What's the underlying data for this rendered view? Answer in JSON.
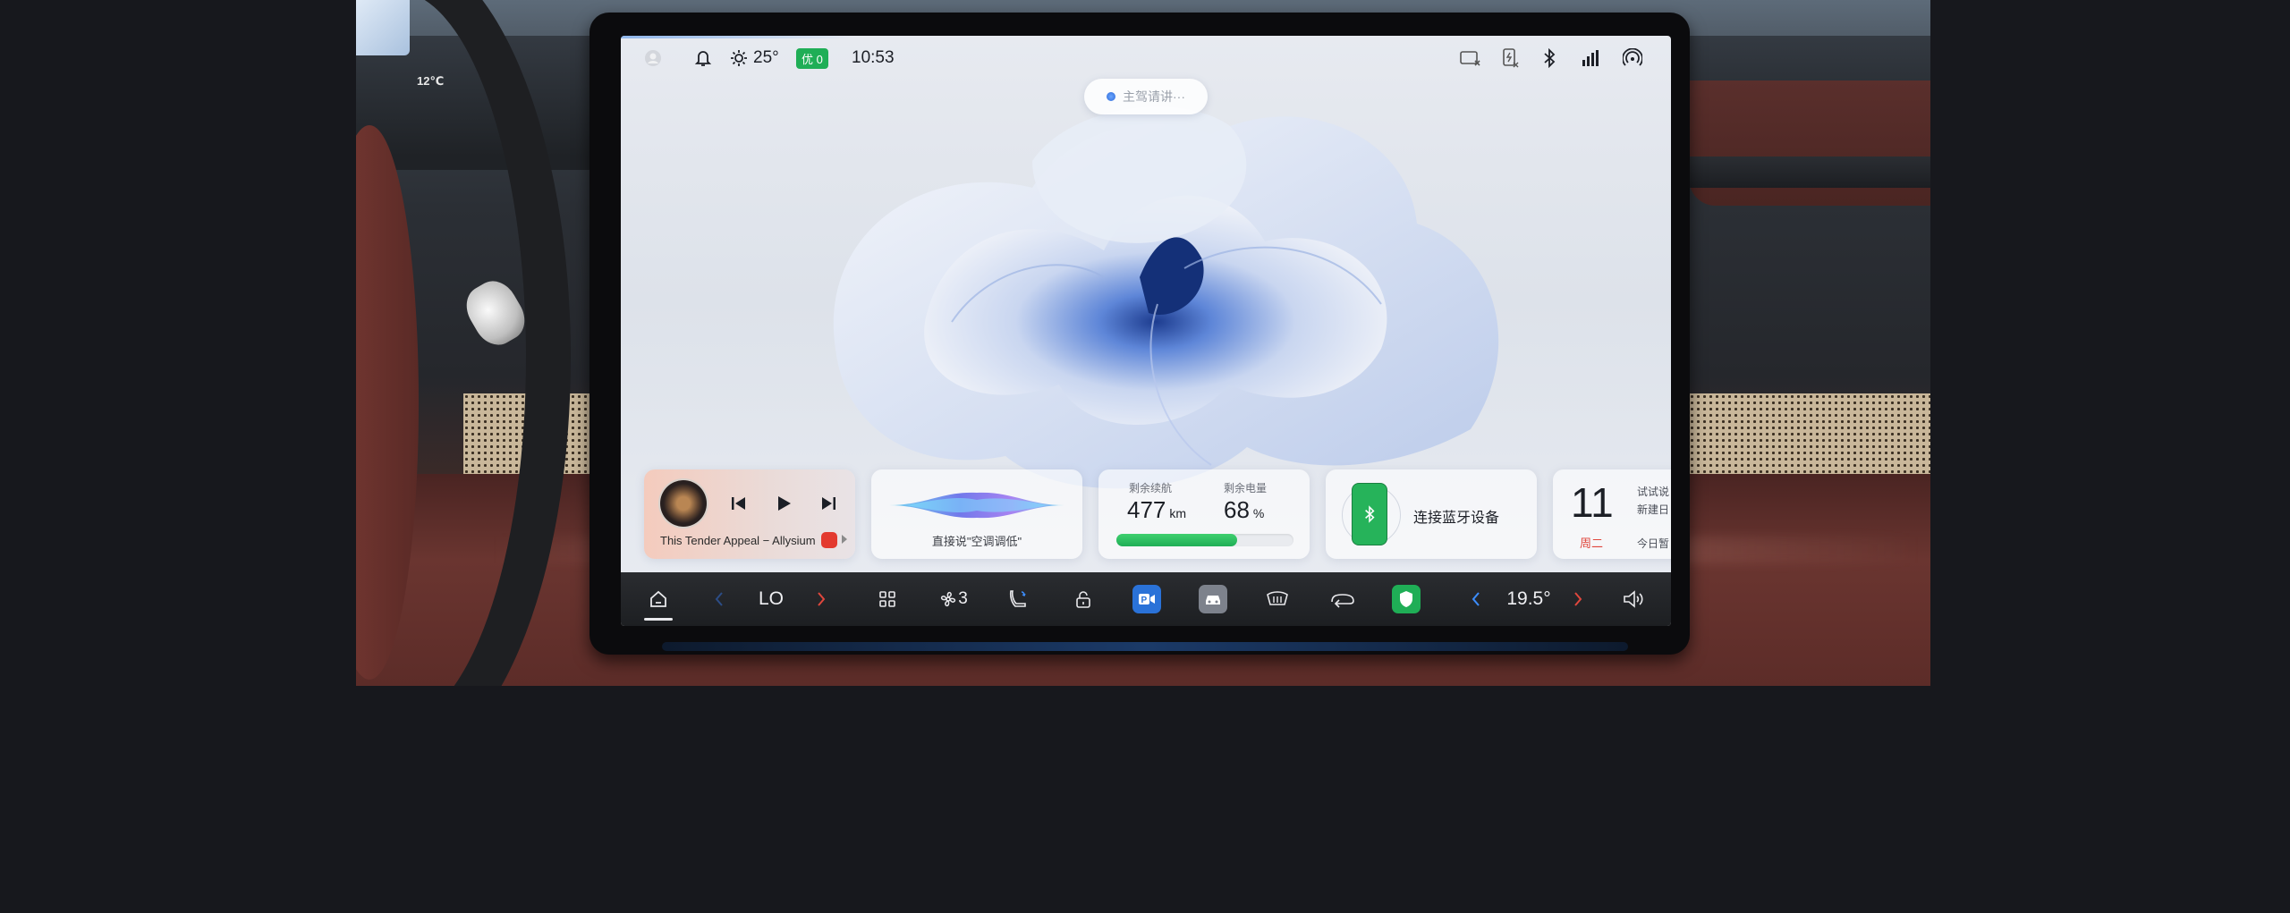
{
  "scene": {
    "cluster_temperature": "12℃"
  },
  "status_bar": {
    "weather_temp": "25°",
    "air_quality": "优 0",
    "time": "10:53",
    "icons": [
      "avatar-icon",
      "bell-icon",
      "sun-icon",
      "record-off-icon",
      "charge-off-icon",
      "bluetooth-icon",
      "signal-icon",
      "hotspot-icon"
    ]
  },
  "voice_assistant": {
    "placeholder": "主驾请讲···"
  },
  "music": {
    "song": "This Tender Appeal − Allysium",
    "icons": [
      "album-art",
      "prev-icon",
      "play-icon",
      "next-icon",
      "netease-music-icon"
    ]
  },
  "voice_card": {
    "hint": "直接说\"空调调低\""
  },
  "energy": {
    "range_label": "剩余续航",
    "range_value": "477",
    "range_unit": "km",
    "battery_label": "剩余电量",
    "battery_value": "68",
    "battery_unit": "%",
    "battery_fraction": 0.68,
    "bar_color": "#1fae56"
  },
  "bluetooth_card": {
    "label": "连接蓝牙设备"
  },
  "calendar": {
    "day": "11",
    "weekday": "周二",
    "line1": "试试说",
    "line2": "新建日",
    "line3": "今日暂"
  },
  "dock": {
    "driver_temp": "LO",
    "fan_level": "3",
    "passenger_temp": "19.5°",
    "icons": [
      "home-icon",
      "chevron-left-icon",
      "chevron-right-icon",
      "apps-grid-icon",
      "fan-icon",
      "seat-icon",
      "lock-icon",
      "camera-app-icon",
      "car-app-icon",
      "rear-defrost-icon",
      "recirculation-icon",
      "security-app-icon",
      "chevron-left-icon",
      "chevron-right-icon",
      "volume-icon"
    ]
  },
  "colors": {
    "accent_blue": "#2a72d8",
    "accent_green": "#1fae56",
    "accent_red": "#e0473d"
  }
}
